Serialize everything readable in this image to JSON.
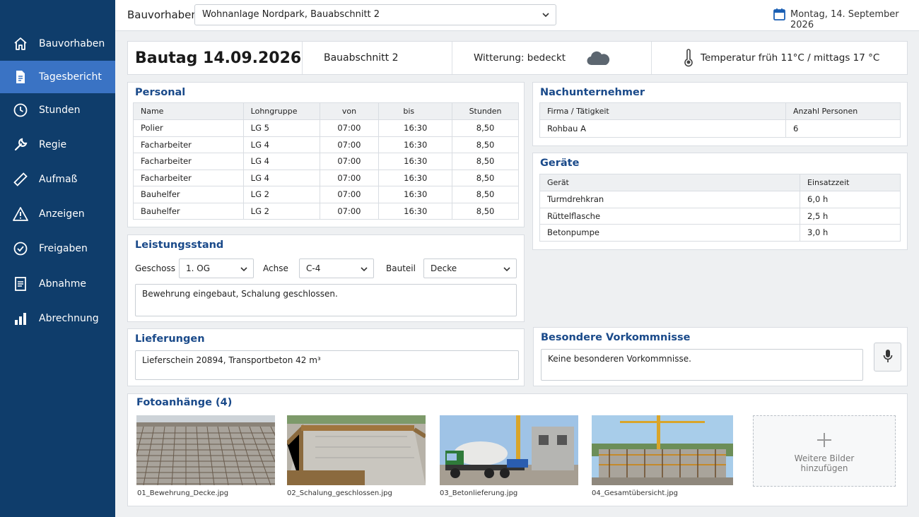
{
  "sidebar": {
    "items": [
      {
        "label": "Bauvorhaben",
        "icon": "home-icon"
      },
      {
        "label": "Tagesbericht",
        "icon": "document-icon",
        "active": true
      },
      {
        "label": "Stunden",
        "icon": "clock-icon"
      },
      {
        "label": "Regie",
        "icon": "wrench-icon"
      },
      {
        "label": "Aufmaß",
        "icon": "ruler-icon"
      },
      {
        "label": "Anzeigen",
        "icon": "warning-icon"
      },
      {
        "label": "Freigaben",
        "icon": "check-circle-icon"
      },
      {
        "label": "Abnahme",
        "icon": "clipboard-icon"
      },
      {
        "label": "Abrechnung",
        "icon": "bar-chart-icon"
      }
    ]
  },
  "topbar": {
    "project_label": "Bauvorhaben",
    "project_value": "Wohnanlage Nordpark, Bauabschnitt 2",
    "date": "Montag, 14. September 2026"
  },
  "header": {
    "title": "Bautag 14.09.2026",
    "section": "Bauabschnitt 2",
    "weather": "Witterung: bedeckt",
    "temperature": "Temperatur früh 11°C / mittags 17 °C"
  },
  "personal": {
    "title": "Personal",
    "columns": [
      "Name",
      "Lohngruppe",
      "von",
      "bis",
      "Stunden"
    ],
    "rows": [
      [
        "Polier",
        "LG 5",
        "07:00",
        "16:30",
        "8,50"
      ],
      [
        "Facharbeiter",
        "LG 4",
        "07:00",
        "16:30",
        "8,50"
      ],
      [
        "Facharbeiter",
        "LG 4",
        "07:00",
        "16:30",
        "8,50"
      ],
      [
        "Facharbeiter",
        "LG 4",
        "07:00",
        "16:30",
        "8,50"
      ],
      [
        "Bauhelfer",
        "LG 2",
        "07:00",
        "16:30",
        "8,50"
      ],
      [
        "Bauhelfer",
        "LG 2",
        "07:00",
        "16:30",
        "8,50"
      ]
    ]
  },
  "nachunternehmer": {
    "title": "Nachunternehmer",
    "columns": [
      "Firma / Tätigkeit",
      "Anzahl Personen"
    ],
    "rows": [
      [
        "Rohbau A",
        "6"
      ]
    ]
  },
  "geraete": {
    "title": "Geräte",
    "columns": [
      "Gerät",
      "Einsatzzeit"
    ],
    "rows": [
      [
        "Turmdrehkran",
        "6,0 h"
      ],
      [
        "Rüttelflasche",
        "2,5 h"
      ],
      [
        "Betonpumpe",
        "3,0 h"
      ]
    ]
  },
  "leistungsstand": {
    "title": "Leistungsstand",
    "geschoss_label": "Geschoss",
    "geschoss_value": "1. OG",
    "achse_label": "Achse",
    "achse_value": "C-4",
    "bauteil_label": "Bauteil",
    "bauteil_value": "Decke",
    "text": "Bewehrung eingebaut, Schalung geschlossen."
  },
  "lieferungen": {
    "title": "Lieferungen",
    "text": "Lieferschein 20894, Transportbeton 42 m³"
  },
  "vorkommnisse": {
    "title": "Besondere Vorkommnisse",
    "text": "Keine besonderen Vorkommnisse."
  },
  "fotos": {
    "title": "Fotoanhänge (4)",
    "items": [
      {
        "caption": "01_Bewehrung_Decke.jpg"
      },
      {
        "caption": "02_Schalung_geschlossen.jpg"
      },
      {
        "caption": "03_Betonlieferung.jpg"
      },
      {
        "caption": "04_Gesamtübersicht.jpg"
      }
    ],
    "add_line1": "Weitere Bilder",
    "add_line2": "hinzufügen"
  },
  "colors": {
    "sidebar": "#0f3d6b",
    "active": "#3a73c4",
    "heading": "#1a4a8a"
  }
}
